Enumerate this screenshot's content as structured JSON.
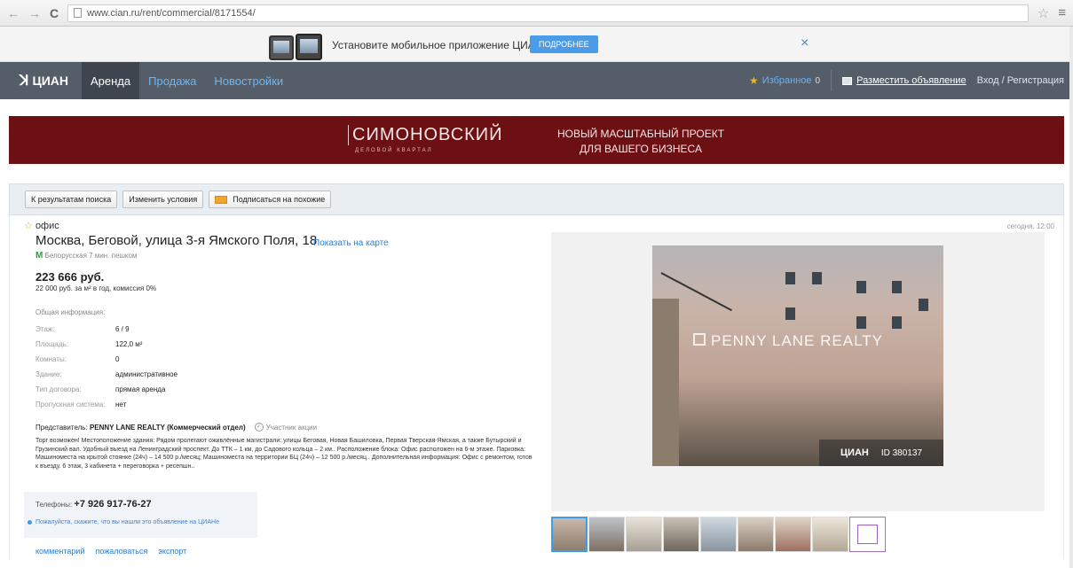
{
  "browser": {
    "url": "www.cian.ru/rent/commercial/8171554/"
  },
  "app_banner": {
    "text": "Установите мобильное приложение ЦИАН",
    "button": "ПОДРОБНЕЕ",
    "close": "×"
  },
  "nav": {
    "logo": "ЦИАН",
    "tabs": [
      {
        "label": "Аренда"
      },
      {
        "label": "Продажа"
      },
      {
        "label": "Новостройки"
      }
    ],
    "favorites": "Избранное",
    "favorites_count": "0",
    "post_ad": "Разместить объявление",
    "login": "Вход / Регистрация"
  },
  "ad_banner": {
    "brand": "СИМОНОВСКИЙ",
    "brand_sub": "ДЕЛОВОЙ КВАРТАЛ",
    "slogan_1": "НОВЫЙ МАСШТАБНЫЙ ПРОЕКТ",
    "slogan_2": "ДЛЯ ВАШЕГО БИЗНЕСА"
  },
  "toolbar": {
    "back": "К результатам поиска",
    "change": "Изменить условия",
    "subscribe": "Подписаться на похожие"
  },
  "listing": {
    "type": "офис",
    "address": "Москва, Беговой, улица 3-я Ямского Поля, 18",
    "map_link": "Показать на карте",
    "metro": "Белорусская 7 мин. пешком",
    "price": "223 666 руб.",
    "price_sub": "22 000 руб. за м² в год, комиссия 0%",
    "date": "сегодня, 12:00",
    "params_head": "Общая информация:",
    "params": [
      {
        "k": "Этаж:",
        "v": "6 / 9"
      },
      {
        "k": "Площадь:",
        "v": "122,0 м²"
      },
      {
        "k": "Комнаты:",
        "v": "0"
      },
      {
        "k": "Здание:",
        "v": "административное"
      },
      {
        "k": "Тип договора:",
        "v": "прямая аренда"
      },
      {
        "k": "Пропускная система:",
        "v": "нет"
      }
    ],
    "rep_label": "Представитель:",
    "rep_name": "PENNY LANE REALTY (Коммерческий отдел)",
    "participant": "Участник акции",
    "description": "Торг возможен! Местоположение здания: Рядом пролегают оживлённые магистрали: улицы Беговая, Новая Башиловка, Первая Тверская-Ямская, а также Бутырский и Грузинский вал. Удобный выезд на Ленинградский проспект. До ТТК – 1 км, до Садового кольца – 2 км.. Расположение блока: Офис расположен на 6-м этаже. Парковка: Машиноместа на крытой стоянке (24ч) – 14 500 р./месяц; Машиноместа на территории БЦ (24ч) – 12 500 р./месяц.. Дополнительная информация: Офис с ремонтом, готов к въезду. 6 этаж, 3 кабинета + переговорка + ресепшн..",
    "phones_label": "Телефоны:",
    "phone": "+7 926 917-76-27",
    "ask": "Пожалуйста, скажите, что вы нашли это объявление на ЦИАНе",
    "links": [
      {
        "label": "комментарий"
      },
      {
        "label": "пожаловаться"
      },
      {
        "label": "экспорт"
      }
    ]
  },
  "photo": {
    "watermark": "PENNY LANE REALTY",
    "logo": "ЦИАН",
    "id": "ID 380137"
  }
}
